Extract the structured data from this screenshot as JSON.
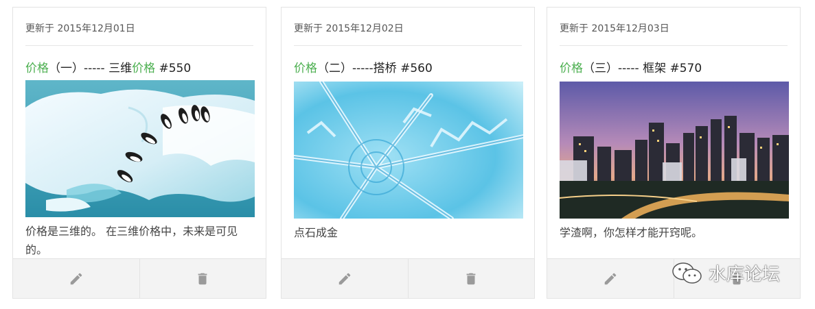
{
  "cards": [
    {
      "updated": "更新于 2015年12月01日",
      "title": {
        "hl1": "价格",
        "mid": "（一）----- 三维",
        "hl2": "价格",
        "tail": " #550"
      },
      "description": "价格是三维的。 在三维价格中，未来是可见的。",
      "image": "penguins-jumping-off-iceberg"
    },
    {
      "updated": "更新于 2015年12月02日",
      "title": {
        "hl1": "价格",
        "mid": "（二）-----搭桥 #560"
      },
      "description": "点石成金",
      "image": "snowflake-closeup"
    },
    {
      "updated": "更新于 2015年12月03日",
      "title": {
        "hl1": "价格",
        "mid": "（三）----- 框架 #570"
      },
      "description": "学渣啊，你怎样才能开窍呢。",
      "image": "city-skyline-at-dusk"
    }
  ],
  "icons": {
    "edit": "pencil-icon",
    "delete": "trash-icon"
  },
  "colors": {
    "highlight": "#4caf50",
    "action_bar": "#f3f3f3",
    "icon": "#9a9a9a"
  },
  "watermark": {
    "text": "水库论坛",
    "icon": "wechat-icon"
  }
}
